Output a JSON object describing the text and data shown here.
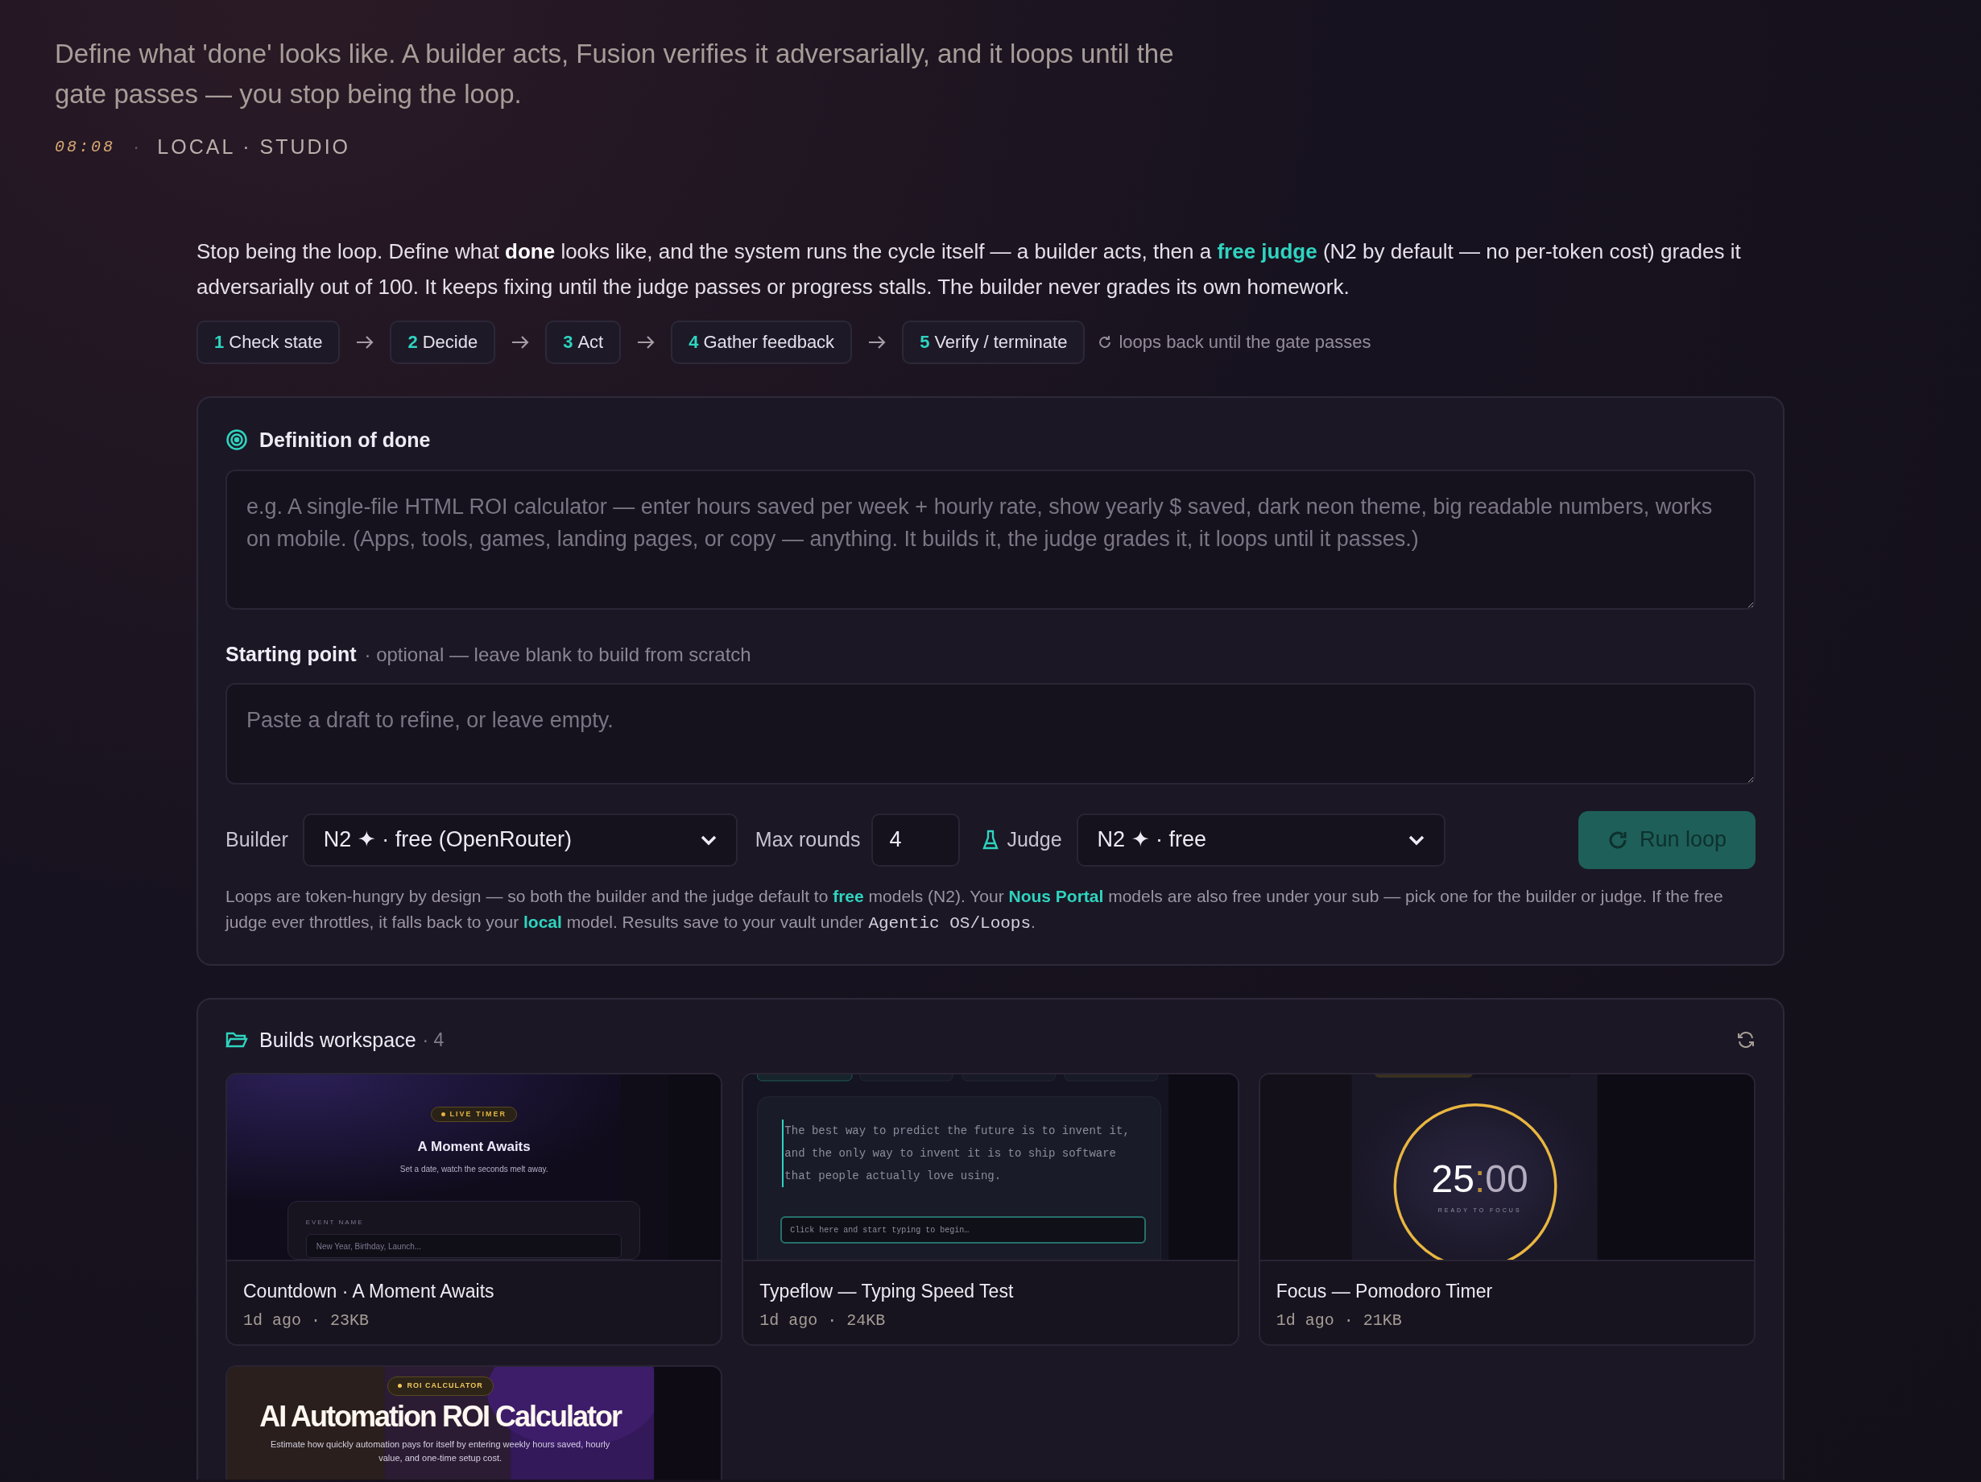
{
  "header": {
    "subtitle": "Define what 'done' looks like. A builder acts, Fusion verifies it adversarially, and it loops until the gate passes — you stop being the loop.",
    "time": "08:08",
    "separator": "·",
    "workspace": "LOCAL · STUDIO"
  },
  "intro": [
    {
      "kind": "text",
      "text": "Stop being the loop. Define what "
    },
    {
      "kind": "strong",
      "text": "done"
    },
    {
      "kind": "text",
      "text": " looks like, and the system runs the cycle itself — a builder acts, then a "
    },
    {
      "kind": "accent",
      "text": "free judge"
    },
    {
      "kind": "text",
      "text": " (N2 by default — no per-token cost) grades it adversarially out of 100. It keeps fixing until the judge passes or progress stalls. The builder never grades its own homework."
    }
  ],
  "steps": [
    {
      "number": "1",
      "label": "Check state"
    },
    {
      "number": "2",
      "label": "Decide"
    },
    {
      "number": "3",
      "label": "Act"
    },
    {
      "number": "4",
      "label": "Gather feedback"
    },
    {
      "number": "5",
      "label": "Verify / terminate"
    }
  ],
  "loop_note": "loops back until the gate passes",
  "definition": {
    "title": "Definition of done",
    "placeholder": "e.g. A single-file HTML ROI calculator — enter hours saved per week + hourly rate, show yearly $ saved, dark neon theme, big readable numbers, works on mobile. (Apps, tools, games, landing pages, or copy — anything. It builds it, the judge grades it, it loops until it passes.)"
  },
  "starting_point": {
    "label": "Starting point",
    "hint": "· optional — leave blank to build from scratch",
    "placeholder": "Paste a draft to refine, or leave empty."
  },
  "controls": {
    "builder_label": "Builder",
    "builder_value": "N2 ✦ · free (OpenRouter)",
    "max_rounds_label": "Max rounds",
    "max_rounds_value": "4",
    "judge_label": "Judge",
    "judge_value": "N2 ✦ · free",
    "run_button": "Run loop"
  },
  "note": [
    {
      "kind": "text",
      "text": "Loops are token-hungry by design — so both the builder and the judge default to "
    },
    {
      "kind": "accent",
      "text": "free"
    },
    {
      "kind": "text",
      "text": " models (N2). Your "
    },
    {
      "kind": "accent",
      "text": "Nous Portal"
    },
    {
      "kind": "text",
      "text": " models are also free under your sub — pick one for the builder or judge. If the free judge ever throttles, it falls back to your "
    },
    {
      "kind": "accent",
      "text": "local"
    },
    {
      "kind": "text",
      "text": " model. Results save to your vault under "
    },
    {
      "kind": "code",
      "text": "Agentic OS/Loops"
    },
    {
      "kind": "text",
      "text": "."
    }
  ],
  "builds": {
    "title": "Builds workspace",
    "count": "· 4",
    "items": [
      {
        "title": "Countdown · A Moment Awaits",
        "meta": "1d ago · 23KB",
        "preview": {
          "kind": "countdown",
          "badge": "LIVE TIMER",
          "heading": "A Moment Awaits",
          "subheading": "Set a date, watch the seconds melt away.",
          "field_label": "EVENT NAME",
          "placeholder": "New Year, Birthday, Launch..."
        }
      },
      {
        "title": "Typeflow — Typing Speed Test",
        "meta": "1d ago · 24KB",
        "preview": {
          "kind": "typing",
          "passage": "The best way to predict the future is to invent it, and the only way to invent it is to ship software that people actually love using.",
          "placeholder": "Click here and start typing to begin…"
        }
      },
      {
        "title": "Focus — Pomodoro Timer",
        "meta": "1d ago · 21KB",
        "preview": {
          "kind": "timer",
          "minutes": "25",
          "separator": ":",
          "seconds": "00",
          "caption": "READY TO FOCUS"
        }
      },
      {
        "preview": {
          "kind": "calculator",
          "badge": "ROI CALCULATOR",
          "heading": "AI Automation ROI Calculator",
          "subheading": "Estimate how quickly automation pays for itself by entering weekly hours saved, hourly value, and one-time setup cost."
        }
      }
    ]
  }
}
